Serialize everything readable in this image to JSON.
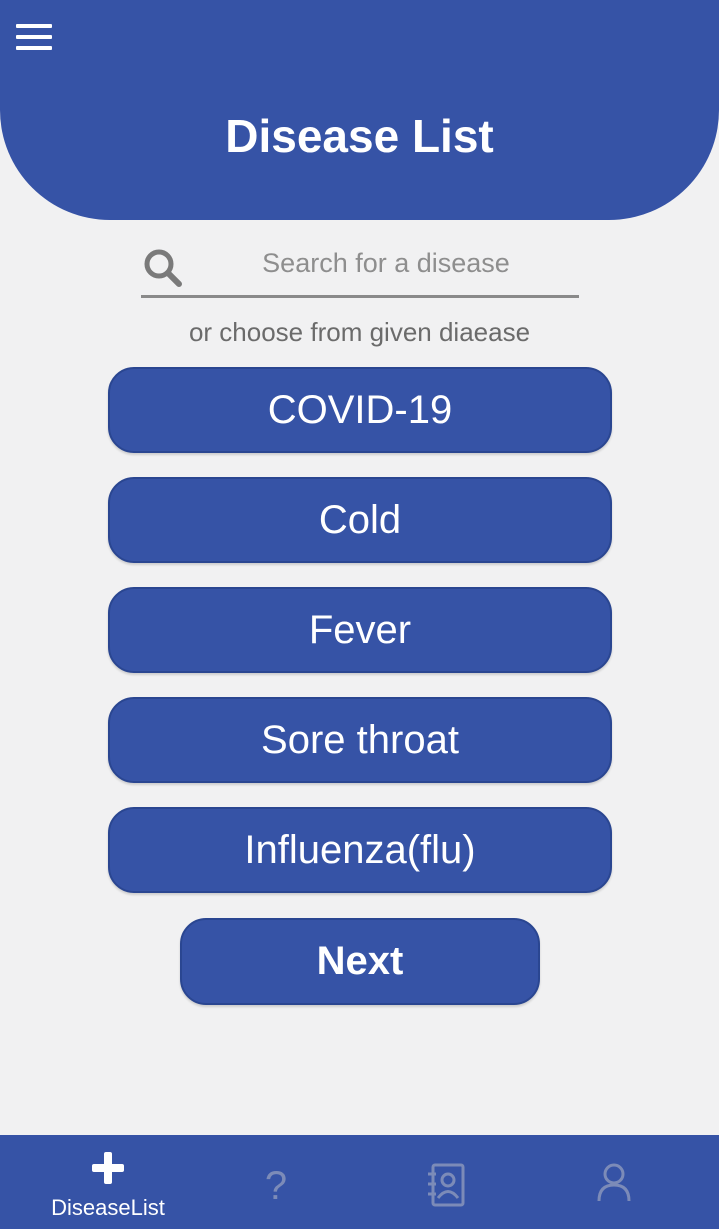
{
  "header": {
    "title": "Disease List",
    "menu_icon": "hamburger-menu-icon"
  },
  "search": {
    "placeholder": "Search for a disease",
    "value": "",
    "icon": "search-icon"
  },
  "hint": "or choose from given diaease",
  "diseases": [
    {
      "label": "COVID-19"
    },
    {
      "label": "Cold"
    },
    {
      "label": "Fever"
    },
    {
      "label": "Sore throat"
    },
    {
      "label": "Influenza(flu)"
    }
  ],
  "next_label": "Next",
  "bottom_nav": {
    "items": [
      {
        "label": "DiseaseList",
        "icon": "plus-icon",
        "active": true
      },
      {
        "label": "",
        "icon": "question-icon",
        "active": false
      },
      {
        "label": "",
        "icon": "contacts-icon",
        "active": false
      },
      {
        "label": "",
        "icon": "person-icon",
        "active": false
      }
    ]
  },
  "colors": {
    "primary": "#3653a6",
    "background": "#f1f1f2",
    "inactive_icon": "#7c8bb8"
  }
}
